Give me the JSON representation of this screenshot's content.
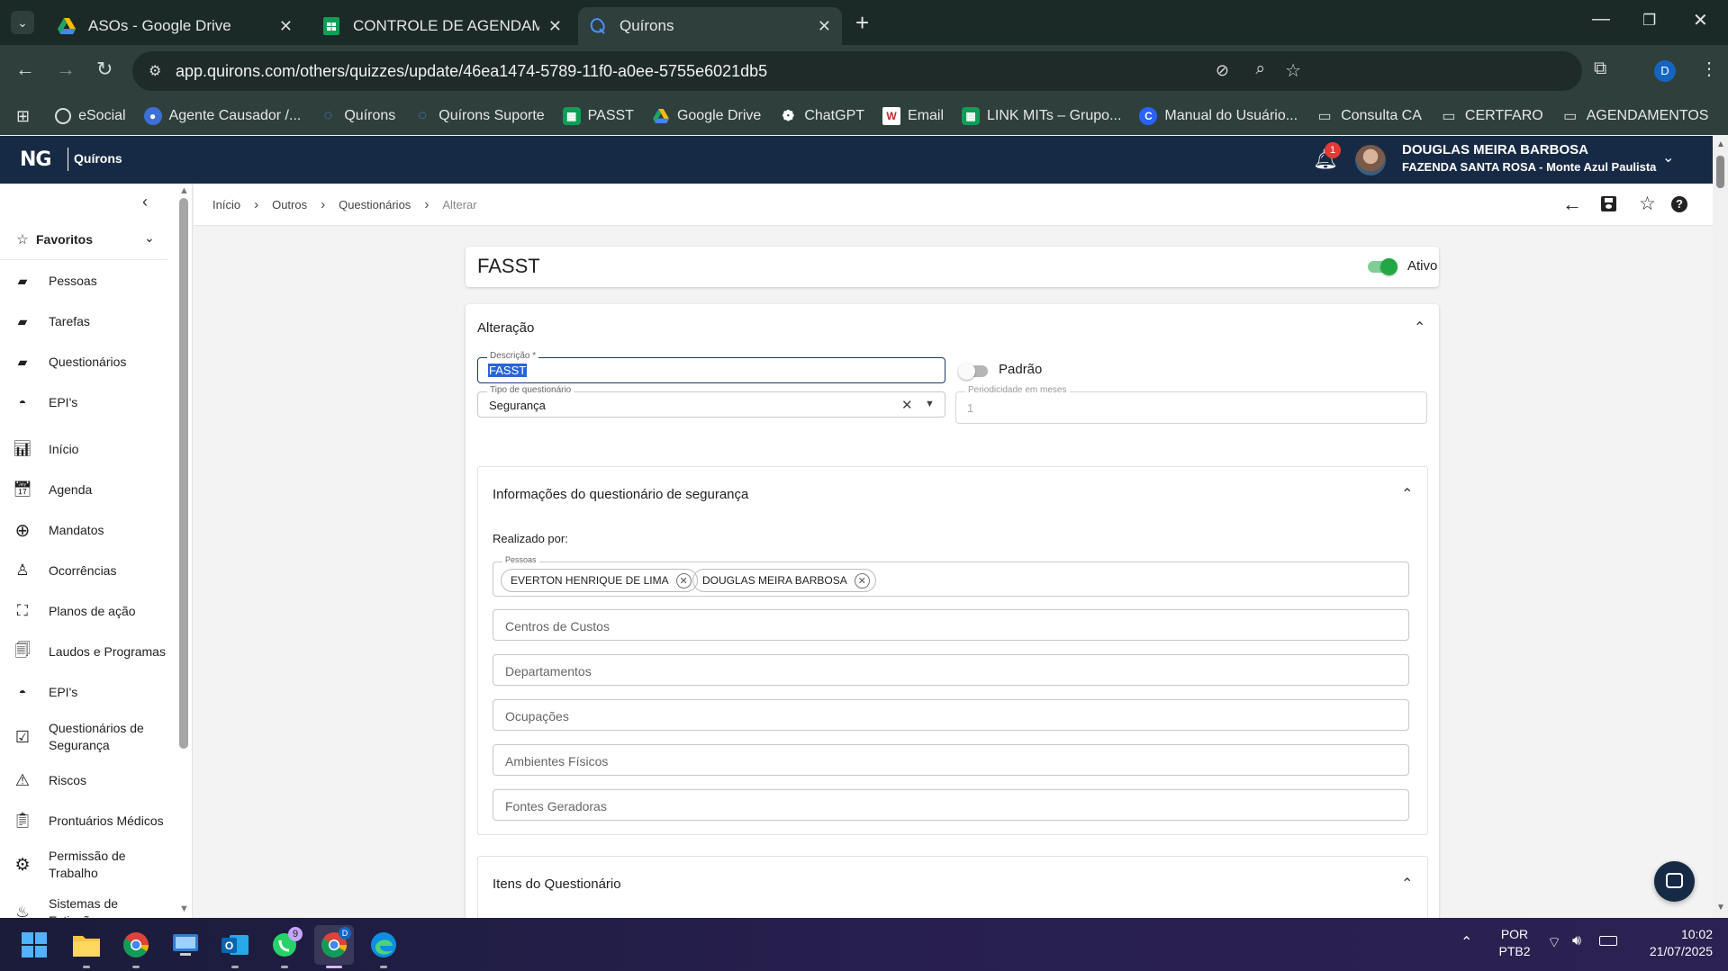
{
  "browser": {
    "tabs": [
      {
        "title": "ASOs - Google Drive",
        "icon": "google-drive-icon",
        "active": false
      },
      {
        "title": "CONTROLE DE AGENDAMENTO",
        "icon": "google-sheets-icon",
        "active": false
      },
      {
        "title": "Quírons",
        "icon": "quirons-icon",
        "active": true
      }
    ],
    "new_tab": "+",
    "url": "app.quirons.com/others/quizzes/update/46ea1474-5789-11f0-a0ee-5755e6021db5",
    "profile_initial": "D",
    "bookmarks": [
      {
        "label": "eSocial",
        "icon": "esocial-icon"
      },
      {
        "label": "Agente Causador /...",
        "icon": "agent-icon"
      },
      {
        "label": "Quírons",
        "icon": "quirons-icon"
      },
      {
        "label": "Quírons Suporte",
        "icon": "quirons-icon"
      },
      {
        "label": "PASST",
        "icon": "sheets-icon"
      },
      {
        "label": "Google Drive",
        "icon": "drive-icon"
      },
      {
        "label": "ChatGPT",
        "icon": "chatgpt-icon"
      },
      {
        "label": "Email",
        "icon": "email-icon"
      },
      {
        "label": "LINK MITs – Grupo...",
        "icon": "sheets-icon"
      },
      {
        "label": "Manual do Usuário...",
        "icon": "manual-icon"
      },
      {
        "label": "Consulta CA",
        "icon": "folder-icon"
      },
      {
        "label": "CERTFARO",
        "icon": "folder-icon"
      },
      {
        "label": "AGENDAMENTOS",
        "icon": "folder-icon"
      }
    ]
  },
  "app": {
    "logo_text": "Quírons",
    "notification_count": "1",
    "user_name": "DOUGLAS MEIRA BARBOSA",
    "user_company": "FAZENDA SANTA ROSA - Monte Azul Paulista"
  },
  "sidebar": {
    "favorites_label": "Favoritos",
    "favorites": [
      {
        "label": "Pessoas",
        "icon": "folder-icon"
      },
      {
        "label": "Tarefas",
        "icon": "folder-icon"
      },
      {
        "label": "Questionários",
        "icon": "folder-icon"
      },
      {
        "label": "EPI's",
        "icon": "helmet-icon"
      }
    ],
    "items": [
      {
        "label": "Início",
        "icon": "chart-icon"
      },
      {
        "label": "Agenda",
        "icon": "calendar-icon"
      },
      {
        "label": "Mandatos",
        "icon": "plus-circle-icon"
      },
      {
        "label": "Ocorrências",
        "icon": "person-icon"
      },
      {
        "label": "Planos de ação",
        "icon": "network-icon"
      },
      {
        "label": "Laudos e Programas",
        "icon": "documents-icon"
      },
      {
        "label": "EPI's",
        "icon": "helmet-icon"
      },
      {
        "label": "Questionários de Segurança",
        "icon": "checkbox-icon"
      },
      {
        "label": "Riscos",
        "icon": "warning-icon"
      },
      {
        "label": "Prontuários Médicos",
        "icon": "clipboard-icon"
      },
      {
        "label": "Permissão de Trabalho",
        "icon": "gear-icon"
      },
      {
        "label": "Sistemas de Extinção",
        "icon": "extinguisher-icon"
      }
    ]
  },
  "breadcrumb": [
    "Início",
    "Outros",
    "Questionários",
    "Alterar"
  ],
  "form": {
    "title": "FASST",
    "active_label": "Ativo",
    "active": true,
    "section_title": "Alteração",
    "descricao_label": "Descrição *",
    "descricao_value": "FASST",
    "padrao_label": "Padrão",
    "padrao": false,
    "tipo_label": "Tipo de questionário",
    "tipo_value": "Segurança",
    "periodicidade_label": "Periodicidade em meses",
    "periodicidade_value": "1",
    "info_section_title": "Informações do questionário de segurança",
    "realizado_por": "Realizado por:",
    "pessoas_label": "Pessoas",
    "pessoas": [
      "EVERTON HENRIQUE DE LIMA",
      "DOUGLAS MEIRA BARBOSA"
    ],
    "centros_custos": "Centros de Custos",
    "departamentos": "Departamentos",
    "ocupacoes": "Ocupações",
    "ambientes_fisicos": "Ambientes Físicos",
    "fontes_geradoras": "Fontes Geradoras",
    "itens_section_title": "Itens do Questionário"
  },
  "taskbar": {
    "whatsapp_badge": "9",
    "chrome_profile": "D",
    "language": "POR",
    "keyboard": "PTB2",
    "time": "10:02",
    "date": "21/07/2025"
  },
  "colors": {
    "app_header": "#172a45",
    "accent_green": "#23a744",
    "notification_red": "#e53935"
  }
}
